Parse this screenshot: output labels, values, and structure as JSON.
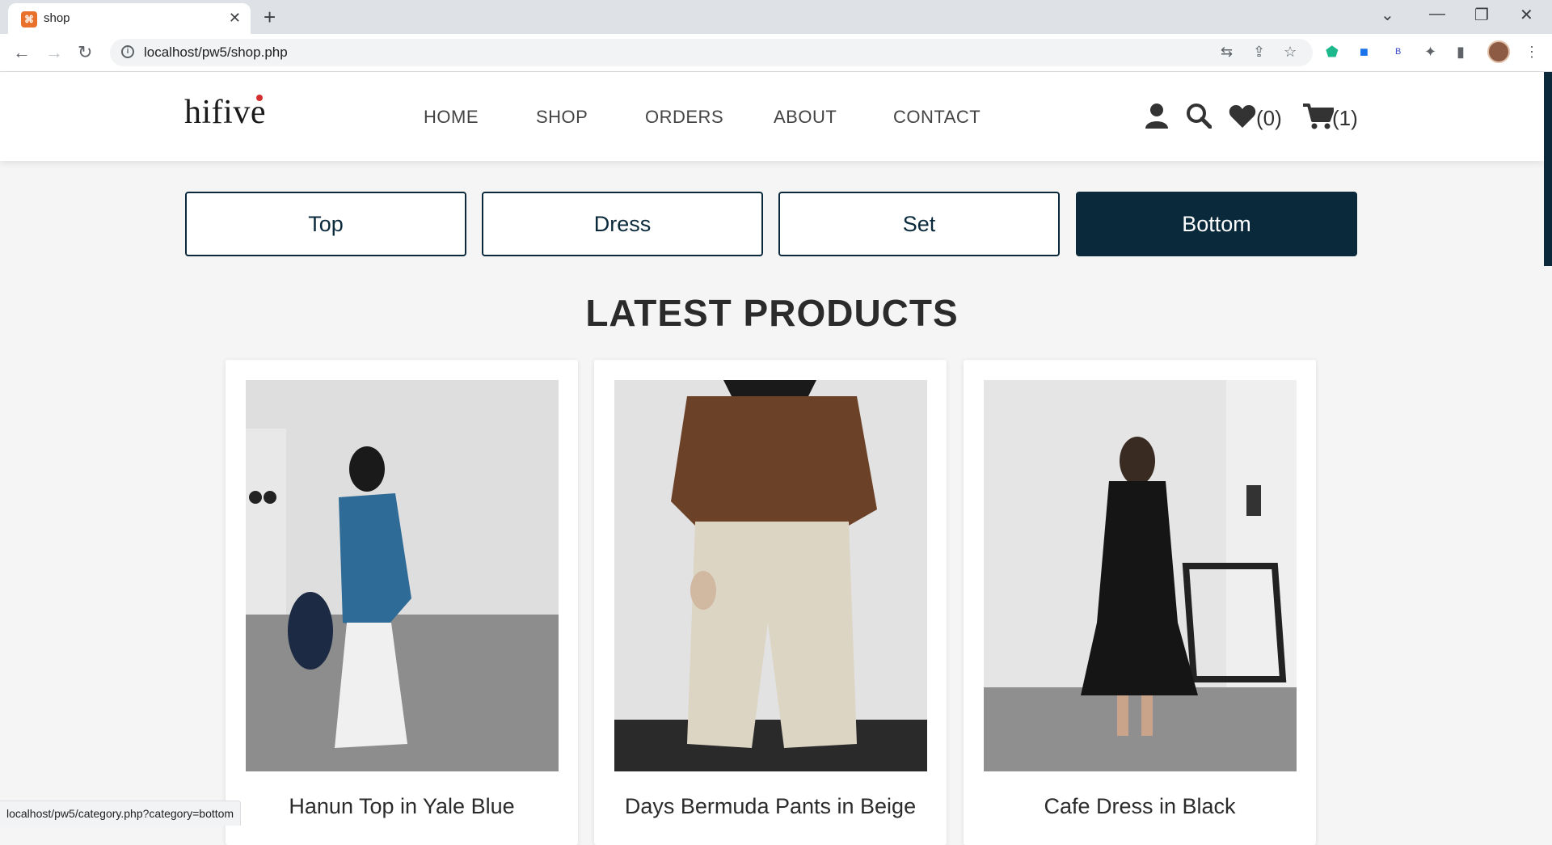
{
  "browser": {
    "tab_title": "shop",
    "url": "localhost/pw5/shop.php",
    "status_url": "localhost/pw5/category.php?category=bottom"
  },
  "site": {
    "logo": "hifive",
    "nav": [
      "HOME",
      "SHOP",
      "ORDERS",
      "ABOUT",
      "CONTACT"
    ],
    "wishlist_count": "(0)",
    "cart_count": "(1)"
  },
  "categories": [
    {
      "label": "Top",
      "active": false
    },
    {
      "label": "Dress",
      "active": false
    },
    {
      "label": "Set",
      "active": false
    },
    {
      "label": "Bottom",
      "active": true
    }
  ],
  "section_title": "LATEST PRODUCTS",
  "products": [
    {
      "name": "Hanun Top in Yale Blue"
    },
    {
      "name": "Days Bermuda Pants in Beige"
    },
    {
      "name": "Cafe Dress in Black"
    }
  ],
  "colors": {
    "primary": "#0a2a3c",
    "background": "#f5f5f5"
  }
}
